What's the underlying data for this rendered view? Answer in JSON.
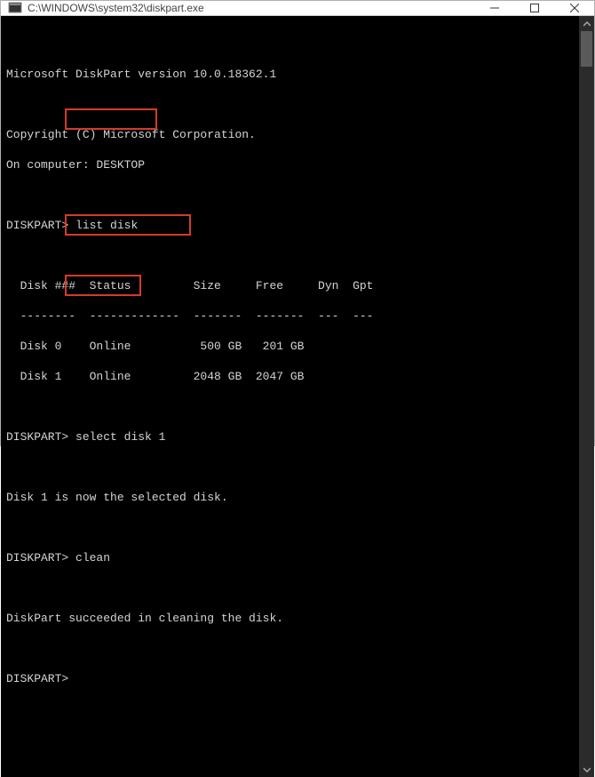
{
  "window": {
    "title": "C:\\WINDOWS\\system32\\diskpart.exe"
  },
  "console": {
    "version_line": "Microsoft DiskPart version 10.0.18362.1",
    "copyright_line": "Copyright (C) Microsoft Corporation.",
    "computer_line": "On computer: DESKTOP",
    "prompt": "DISKPART>",
    "cmd1": "list disk",
    "table_header": "  Disk ###  Status         Size     Free     Dyn  Gpt",
    "table_divider": "  --------  -------------  -------  -------  ---  ---",
    "table_row1": "  Disk 0    Online          500 GB   201 GB",
    "table_row2": "  Disk 1    Online         2048 GB  2047 GB",
    "cmd2": "select disk 1",
    "select_result": "Disk 1 is now the selected disk.",
    "cmd3": "clean",
    "clean_result": "DiskPart succeeded in cleaning the disk."
  },
  "highlights": {
    "h1": "list disk",
    "h2": "select disk 1",
    "h3": "clean"
  }
}
